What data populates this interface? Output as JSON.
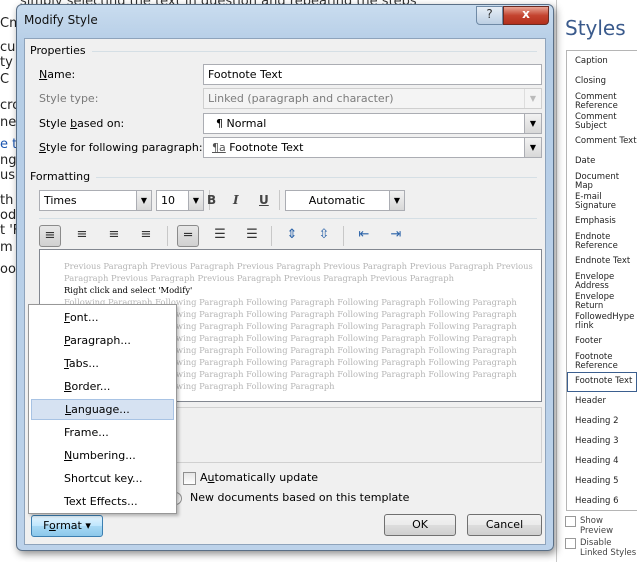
{
  "background_doc": {
    "top_line": "simply selecting the text in question and repeating the steps",
    "fragments": [
      "Cm",
      "cu",
      "ty",
      "C",
      "cro",
      "ne",
      "e t",
      "ng",
      "us",
      "th",
      "od",
      "t 'F",
      "m",
      "oot"
    ]
  },
  "dialog": {
    "title": "Modify Style",
    "help": "?",
    "close": "x",
    "properties": {
      "group": "Properties",
      "name_label": "Name:",
      "name_value": "Footnote Text",
      "style_type_label": "Style type:",
      "style_type_value": "Linked (paragraph and character)",
      "based_on_label": "Style based on:",
      "based_on_value": "Normal",
      "based_on_icon": "¶",
      "following_label": "Style for following paragraph:",
      "following_value": "Footnote Text",
      "following_icon": "¶a"
    },
    "formatting": {
      "group": "Formatting",
      "font": "Times",
      "size": "10",
      "bold": "B",
      "italic": "I",
      "underline": "U",
      "color": "Automatic"
    },
    "preview": {
      "previous": "Previous Paragraph Previous Paragraph Previous Paragraph Previous Paragraph Previous Paragraph Previous",
      "previous2": "Paragraph Previous Paragraph Previous Paragraph Previous Paragraph Previous Paragraph",
      "sample": "Right click and select 'Modify'",
      "following": "Following Paragraph Following Paragraph Following Paragraph Following Paragraph Following Paragraph",
      "following_last": "Following Paragraph Following Paragraph Following Paragraph"
    },
    "auto_update": "Automatically update",
    "new_docs": "New documents based on this template",
    "format_button": "Format",
    "ok": "OK",
    "cancel": "Cancel",
    "format_menu": [
      "Font...",
      "Paragraph...",
      "Tabs...",
      "Border...",
      "Language...",
      "Frame...",
      "Numbering...",
      "Shortcut key...",
      "Text Effects..."
    ],
    "highlighted_item": "Language..."
  },
  "styles_pane": {
    "title": "Styles",
    "items": [
      "Caption",
      "Closing",
      "Comment Reference",
      "Comment Subject",
      "Comment Text",
      "Date",
      "Document Map",
      "E-mail Signature",
      "Emphasis",
      "Endnote Reference",
      "Endnote Text",
      "Envelope Address",
      "Envelope Return",
      "FollowedHyperlink",
      "Footer",
      "Footnote Reference",
      "Footnote Text",
      "Header",
      "Heading 2",
      "Heading 3",
      "Heading 4",
      "Heading 5",
      "Heading 6"
    ],
    "selected": "Footnote Text",
    "show_preview": "Show Preview",
    "disable_linked": "Disable Linked Styles"
  },
  "colors": {
    "title_bar": "#bcd2ea",
    "close": "#c4432f",
    "menu_highlight": "#d6e2f2",
    "styles_title": "#3a5a8c"
  }
}
